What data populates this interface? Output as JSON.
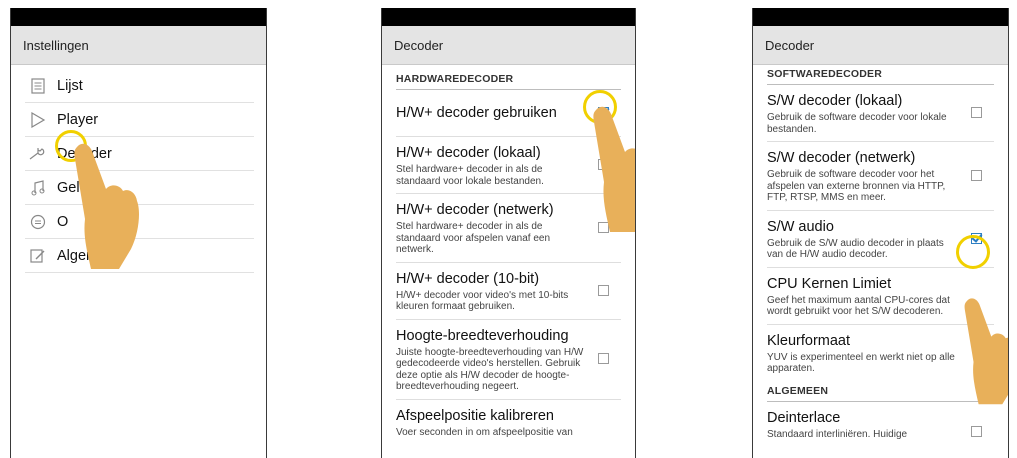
{
  "screens": [
    {
      "title": "Instellingen",
      "menu": [
        {
          "label": "Lijst",
          "icon": "list-icon"
        },
        {
          "label": "Player",
          "icon": "play-icon"
        },
        {
          "label": "Decoder",
          "icon": "wrench-icon"
        },
        {
          "label": "Gel",
          "icon": "music-icon"
        },
        {
          "label": "O",
          "icon": "chat-icon"
        },
        {
          "label": "Algen",
          "icon": "edit-icon"
        }
      ]
    },
    {
      "title": "Decoder",
      "section": "HARDWAREDECODER",
      "items": [
        {
          "title": "H/W+ decoder gebruiken",
          "summary": "",
          "checked": true
        },
        {
          "title": "H/W+ decoder (lokaal)",
          "summary": "Stel hardware+ decoder in als de standaard voor lokale bestanden.",
          "checked": false
        },
        {
          "title": "H/W+ decoder (netwerk)",
          "summary": "Stel hardware+ decoder in als de standaard voor afspelen vanaf een netwerk.",
          "checked": false
        },
        {
          "title": "H/W+ decoder (10-bit)",
          "summary": "H/W+ decoder voor video's met 10-bits kleuren formaat gebruiken.",
          "checked": false
        },
        {
          "title": "Hoogte-breedteverhouding",
          "summary": "Juiste hoogte-breedteverhouding van H/W gedecodeerde video's herstellen. Gebruik deze optie als H/W decoder de hoogte-breedteverhouding negeert.",
          "checked": false
        },
        {
          "title": "Afspeelpositie kalibreren",
          "summary": "Voer seconden in om afspeelpositie van",
          "checked": null
        }
      ]
    },
    {
      "title": "Decoder",
      "section": "SOFTWAREDECODER",
      "items": [
        {
          "title": "S/W decoder (lokaal)",
          "summary": "Gebruik de software decoder voor lokale bestanden.",
          "checked": false
        },
        {
          "title": "S/W decoder (netwerk)",
          "summary": "Gebruik de software decoder voor het afspelen van externe bronnen via HTTP, FTP, RTSP, MMS en meer.",
          "checked": false
        },
        {
          "title": "S/W audio",
          "summary": "Gebruik de S/W audio decoder in plaats van de H/W audio decoder.",
          "checked": true
        },
        {
          "title": "CPU Kernen Limiet",
          "summary": "Geef het maximum aantal CPU-cores dat wordt gebruikt voor het S/W decoderen.",
          "checked": null
        },
        {
          "title": "Kleurformaat",
          "summary": "YUV is experimenteel en werkt niet op alle apparaten.",
          "checked": null
        }
      ],
      "section2": "ALGEMEEN",
      "items2": [
        {
          "title": "Deinterlace",
          "summary": "Standaard interliniëren. Huidige",
          "checked": false
        }
      ]
    }
  ],
  "colors": {
    "ring": "#f1d000",
    "hand": "#e8b05a",
    "accent": "#2d7fc3"
  }
}
